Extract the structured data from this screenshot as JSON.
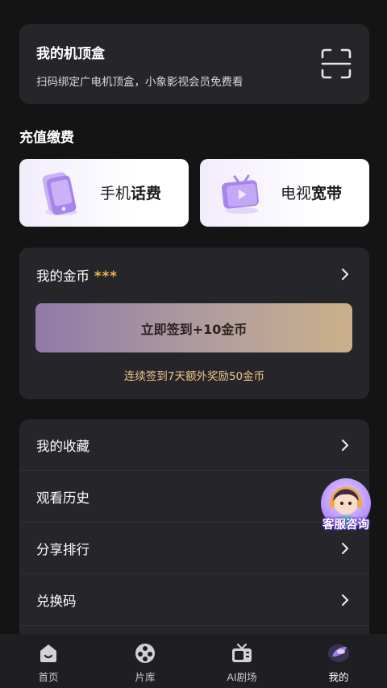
{
  "set_top_box": {
    "title": "我的机顶盒",
    "subtitle": "扫码绑定广电机顶盒，小象影视会员免费看",
    "scan_icon": "scan-icon"
  },
  "recharge": {
    "section_title": "充值缴费",
    "items": [
      {
        "label_a": "手机",
        "label_b": "话费",
        "icon": "phone-icon"
      },
      {
        "label_a": "电视",
        "label_b": "宽带",
        "icon": "tv-icon"
      }
    ]
  },
  "coins": {
    "title": "我的金币",
    "masked_value": "***",
    "checkin_button": "立即签到+10金币",
    "tip": "连续签到7天额外奖励50金币"
  },
  "menu": {
    "items": [
      {
        "label": "我的收藏"
      },
      {
        "label": "观看历史"
      },
      {
        "label": "分享排行"
      },
      {
        "label": "兑换码"
      }
    ]
  },
  "customer_service": {
    "label": "客服咨询"
  },
  "tabbar": {
    "tabs": [
      {
        "label": "首页",
        "icon": "home-icon"
      },
      {
        "label": "片库",
        "icon": "film-reel-icon"
      },
      {
        "label": "AI剧场",
        "icon": "tv-theater-icon"
      },
      {
        "label": "我的",
        "icon": "profile-icon"
      }
    ],
    "active_index": 3
  },
  "colors": {
    "background": "#141414",
    "card": "#26262a",
    "gold": "#f3b64a",
    "tip": "#f0c48c",
    "accent_purple": "#9b6cf5"
  }
}
